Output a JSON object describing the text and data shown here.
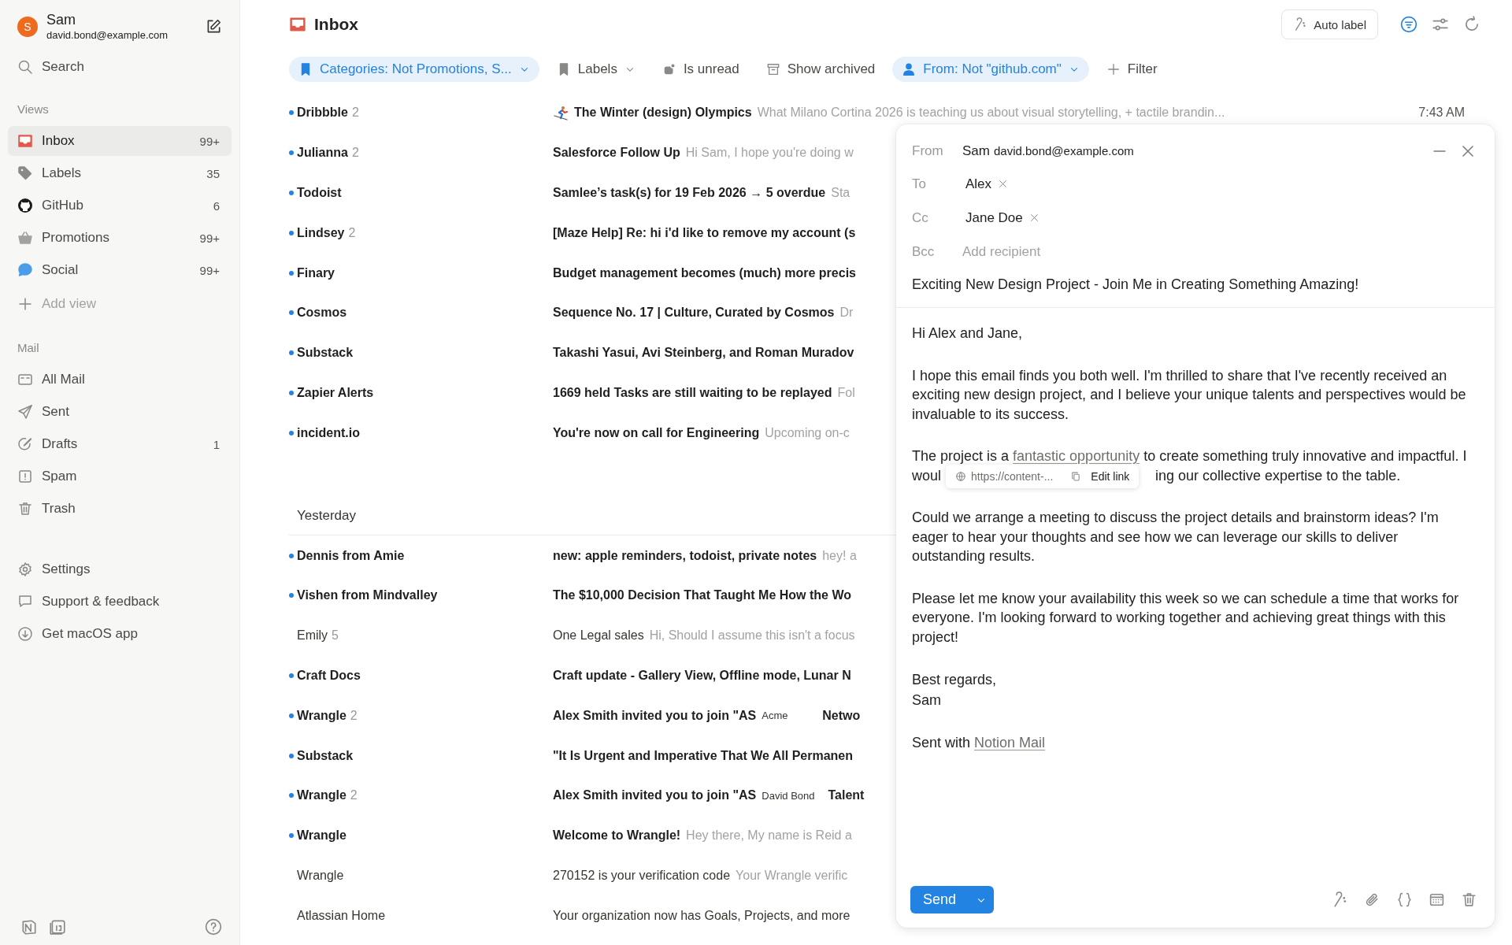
{
  "account": {
    "avatar": "S",
    "name": "Sam",
    "email": "david.bond@example.com"
  },
  "search": {
    "label": "Search"
  },
  "views": {
    "heading": "Views",
    "items": [
      {
        "label": "Inbox",
        "count": "99+",
        "selected": true
      },
      {
        "label": "Labels",
        "count": "35",
        "selected": false
      },
      {
        "label": "GitHub",
        "count": "6",
        "selected": false
      },
      {
        "label": "Promotions",
        "count": "99+",
        "selected": false
      },
      {
        "label": "Social",
        "count": "99+",
        "selected": false
      }
    ],
    "add_label": "Add view"
  },
  "mail": {
    "heading": "Mail",
    "items": [
      {
        "label": "All Mail",
        "selected": false
      },
      {
        "label": "Sent",
        "selected": false
      },
      {
        "label": "Drafts",
        "count": "1",
        "selected": false
      },
      {
        "label": "Spam",
        "selected": false
      },
      {
        "label": "Trash",
        "selected": false
      }
    ]
  },
  "footer_links": [
    {
      "label": "Settings"
    },
    {
      "label": "Support & feedback"
    },
    {
      "label": "Get macOS app"
    }
  ],
  "header": {
    "title": "Inbox",
    "auto_label": "Auto label"
  },
  "filters": [
    {
      "label": "Categories: Not Promotions, S...",
      "active": true,
      "dropdown": true
    },
    {
      "label": "Labels",
      "active": false,
      "dropdown": true
    },
    {
      "label": "Is unread",
      "active": false,
      "dropdown": false
    },
    {
      "label": "Show archived",
      "active": false,
      "dropdown": false
    },
    {
      "label": "From: Not \"github.com\"",
      "active": true,
      "dropdown": true
    },
    {
      "label": "Filter",
      "active": false,
      "dropdown": false
    }
  ],
  "groups": [
    {
      "rows": [
        {
          "sender": "Dribbble",
          "count": "2",
          "unread": true,
          "kind": "icon",
          "subject": "The Winter (design) Olympics",
          "preview": "What Milano Cortina 2026 is teaching us about visual storytelling, + tactile brandin...",
          "time": "7:43 AM"
        },
        {
          "sender": "Julianna",
          "count": "2",
          "unread": true,
          "kind": "plain",
          "subject": "Salesforce Follow Up",
          "preview": "Hi Sam, I hope you're doing w"
        },
        {
          "sender": "Todoist",
          "unread": true,
          "kind": "plain",
          "subject": "Samlee’s task(s) for 19 Feb 2026 → 5 overdue",
          "preview": "Sta"
        },
        {
          "sender": "Lindsey",
          "count": "2",
          "unread": true,
          "kind": "plain",
          "subject": "[Maze Help] Re: hi i'd like to remove my account (s"
        },
        {
          "sender": "Finary",
          "unread": true,
          "kind": "plain",
          "subject": "Budget management becomes (much) more precis"
        },
        {
          "sender": "Cosmos",
          "unread": true,
          "kind": "plain",
          "subject": "Sequence No. 17 | Culture, Curated by Cosmos",
          "preview": "Dr"
        },
        {
          "sender": "Substack",
          "unread": true,
          "kind": "plain",
          "subject": "Takashi Yasui, Avi Steinberg, and Roman Muradov"
        },
        {
          "sender": "Zapier Alerts",
          "unread": true,
          "kind": "plain",
          "subject": "1669 held Tasks are still waiting to be replayed",
          "preview": "Fol"
        },
        {
          "sender": "incident.io",
          "unread": true,
          "kind": "plain",
          "subject": "You're now on call for Engineering",
          "preview": "Upcoming on-c"
        }
      ]
    },
    {
      "heading": "Yesterday",
      "rows": [
        {
          "sender": "Dennis from Amie",
          "unread": true,
          "kind": "plain",
          "subject": "new: apple reminders, todoist, private notes",
          "preview": "hey! a"
        },
        {
          "sender": "Vishen from Mindvalley",
          "unread": true,
          "kind": "plain",
          "subject": "The $10,000 Decision That Taught Me How the Wo"
        },
        {
          "sender": "Emily",
          "count": "5",
          "unread": false,
          "kind": "plain",
          "subject": "One Legal sales",
          "preview": "Hi, Should I assume this isn't a focus"
        },
        {
          "sender": "Craft Docs",
          "unread": true,
          "kind": "plain",
          "subject": "Craft update - Gallery View, Offline mode, Lunar N"
        },
        {
          "sender": "Wrangle",
          "count": "2",
          "unread": true,
          "kind": "tagged",
          "subject": "Alex Smith invited you to join \"AS",
          "tag": "Acme",
          "subject_end": "Netwo"
        },
        {
          "sender": "Substack",
          "unread": true,
          "kind": "plain",
          "subject": "\"It Is Urgent and Imperative That We All Permanen"
        },
        {
          "sender": "Wrangle",
          "count": "2",
          "unread": true,
          "kind": "tagged",
          "subject": "Alex Smith invited you to join \"AS",
          "tag": "David Bond",
          "subject_end": "Talent"
        },
        {
          "sender": "Wrangle",
          "unread": true,
          "kind": "plain",
          "subject": "Welcome to Wrangle!",
          "preview": "Hey there, My name is Reid a"
        },
        {
          "sender": "Wrangle",
          "unread": false,
          "kind": "plain",
          "subject": "270152 is your verification code",
          "preview": "Your Wrangle verific"
        },
        {
          "sender": "Atlassian Home",
          "unread": false,
          "kind": "plain",
          "subject": "Your organization now has Goals, Projects, and more"
        }
      ]
    }
  ],
  "compose": {
    "from_label": "From",
    "from_name": "Sam",
    "from_email": "david.bond@example.com",
    "fields": [
      {
        "label": "To",
        "recipients": [
          "Alex"
        ]
      },
      {
        "label": "Cc",
        "recipients": [
          "Jane Doe"
        ]
      },
      {
        "label": "Bcc",
        "placeholder": "Add recipient"
      }
    ],
    "subject": "Exciting New Design Project - Join Me in Creating Something Amazing!",
    "body": [
      {
        "kind": "text",
        "text": "Hi Alex and Jane,"
      },
      {
        "kind": "text",
        "text": "I hope this email finds you both well. I'm thrilled to share that I've recently received an exciting new design project, and I believe your unique talents and perspectives would be invaluable to its success."
      },
      {
        "kind": "link",
        "before": "The project is a ",
        "link": "fantastic opportunity",
        "after": " to create something truly innovative and impactful. I woul",
        "tooltip_url": "https://content-...",
        "tooltip_action": "Edit link",
        "rest": "ing our collective expertise to the table."
      },
      {
        "kind": "text",
        "text": "Could we arrange a meeting to discuss the project details and brainstorm ideas? I'm eager to hear your thoughts and see how we can leverage our skills to deliver outstanding results."
      },
      {
        "kind": "text",
        "text": "Please let me know your availability this week so we can schedule a time that works for everyone. I'm looking forward to working together and achieving great things with this project!"
      },
      {
        "kind": "lines",
        "lines": [
          "Best regards,",
          "Sam"
        ]
      },
      {
        "kind": "signature",
        "before": "Sent with ",
        "link": "Notion Mail"
      }
    ],
    "send": "Send"
  }
}
